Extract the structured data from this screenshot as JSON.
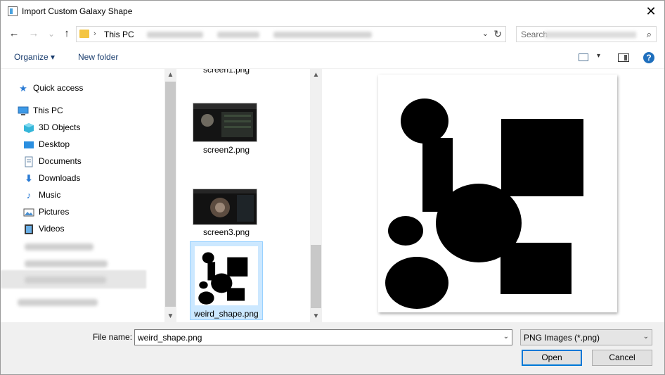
{
  "window": {
    "title": "Import Custom Galaxy Shape",
    "close_glyph": "✕"
  },
  "nav": {
    "back": "←",
    "forward": "→",
    "recent": "⌄",
    "up": "↑"
  },
  "address": {
    "separator": "›",
    "location": "This PC",
    "dropdown": "⌄",
    "refresh": "↻"
  },
  "search": {
    "placeholder": "Search",
    "icon": "⌕"
  },
  "toolbar": {
    "organize": "Organize ▾",
    "new_folder": "New folder",
    "view_dropdown": "▾",
    "help": "?"
  },
  "sidebar": {
    "quick_access": "Quick access",
    "this_pc": "This PC",
    "items": [
      {
        "label": "3D Objects",
        "icon": "cube-icon"
      },
      {
        "label": "Desktop",
        "icon": "desktop-icon"
      },
      {
        "label": "Documents",
        "icon": "documents-icon"
      },
      {
        "label": "Downloads",
        "icon": "download-icon"
      },
      {
        "label": "Music",
        "icon": "music-icon"
      },
      {
        "label": "Pictures",
        "icon": "pictures-icon"
      },
      {
        "label": "Videos",
        "icon": "videos-icon"
      }
    ]
  },
  "files": [
    {
      "name": "screen1.png"
    },
    {
      "name": "screen2.png"
    },
    {
      "name": "screen3.png"
    },
    {
      "name": "weird_shape.png",
      "selected": true
    }
  ],
  "bottom": {
    "file_name_label": "File name:",
    "file_name_value": "weird_shape.png",
    "file_type": "PNG Images (*.png)",
    "dropdown": "⌄",
    "open": "Open",
    "cancel": "Cancel"
  },
  "colors": {
    "accent": "#0078d7",
    "selection": "#cce8ff",
    "link": "#1a3d6e",
    "folder": "#f4c542"
  }
}
